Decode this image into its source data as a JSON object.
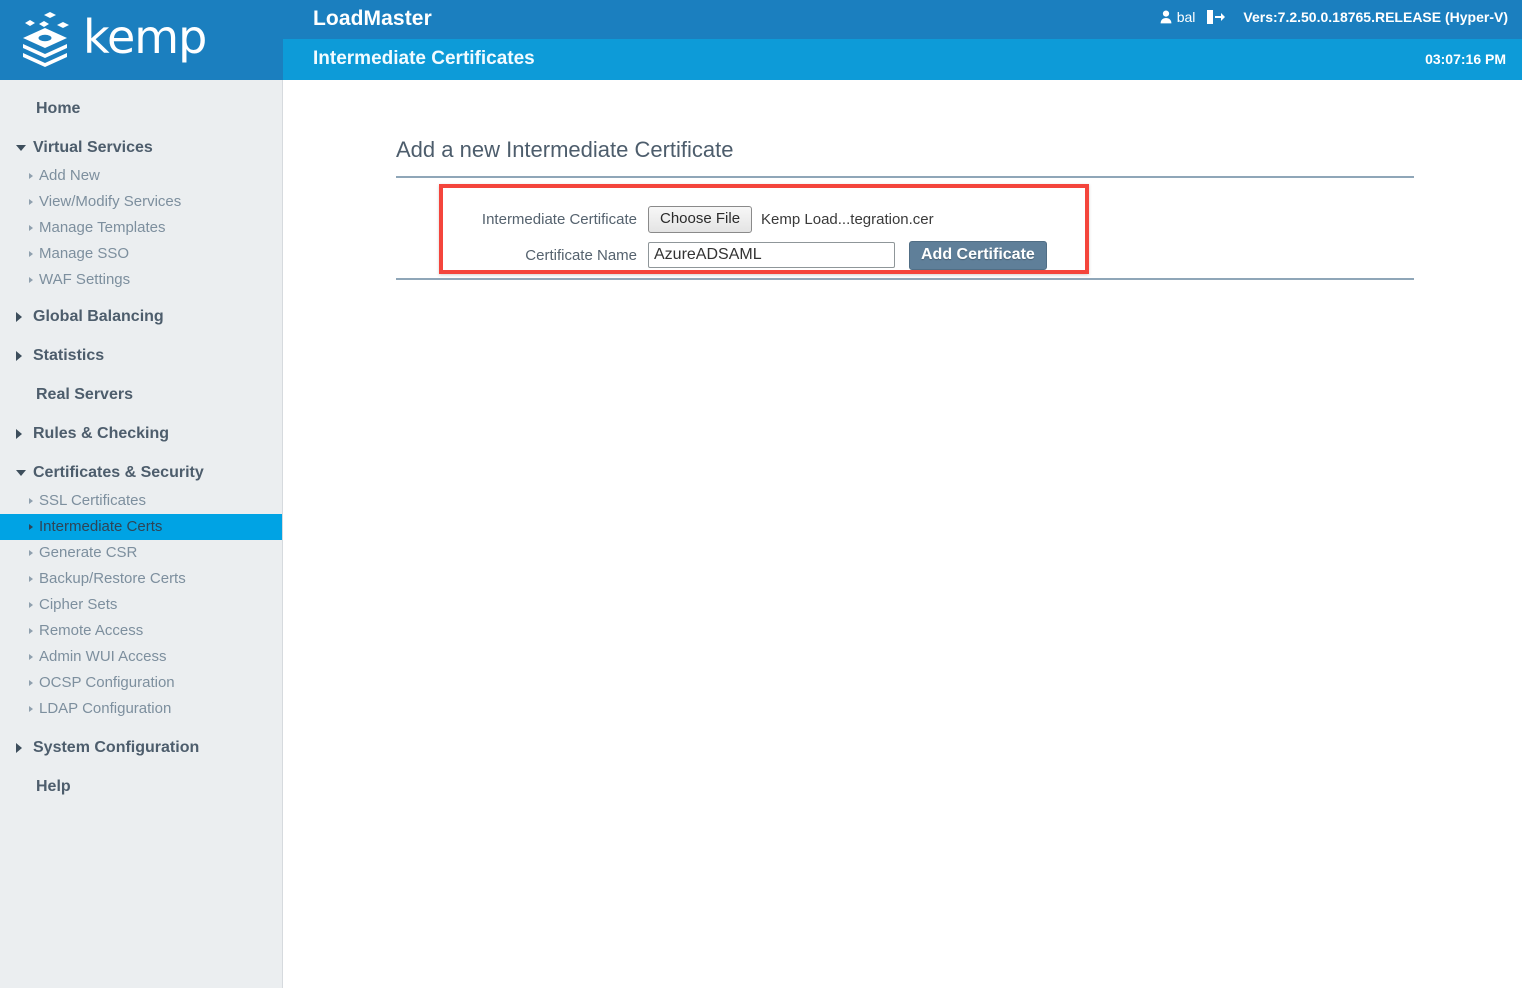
{
  "brand": {
    "name": "kemp",
    "logo_icon": "kemp-layers-logo",
    "header_bg": "#1b7fbf",
    "subheader_bg": "#0d9bd8"
  },
  "header": {
    "app_title": "LoadMaster",
    "page_title": "Intermediate Certificates",
    "user_icon": "user-icon",
    "username": "bal",
    "logout_icon": "logout-icon",
    "version": "Vers:7.2.50.0.18765.RELEASE (Hyper-V)",
    "clock": "03:07:16 PM"
  },
  "sidebar": {
    "home_label": "Home",
    "real_servers_label": "Real Servers",
    "help_label": "Help",
    "groups": [
      {
        "label": "Virtual Services",
        "expanded": true,
        "children": [
          {
            "label": "Add New",
            "active": false
          },
          {
            "label": "View/Modify Services",
            "active": false
          },
          {
            "label": "Manage Templates",
            "active": false
          },
          {
            "label": "Manage SSO",
            "active": false
          },
          {
            "label": "WAF Settings",
            "active": false
          }
        ]
      },
      {
        "label": "Global Balancing",
        "expanded": false,
        "children": []
      },
      {
        "label": "Statistics",
        "expanded": false,
        "children": []
      },
      {
        "label": "Rules & Checking",
        "expanded": false,
        "children": []
      },
      {
        "label": "Certificates & Security",
        "expanded": true,
        "children": [
          {
            "label": "SSL Certificates",
            "active": false
          },
          {
            "label": "Intermediate Certs",
            "active": true
          },
          {
            "label": "Generate CSR",
            "active": false
          },
          {
            "label": "Backup/Restore Certs",
            "active": false
          },
          {
            "label": "Cipher Sets",
            "active": false
          },
          {
            "label": "Remote Access",
            "active": false
          },
          {
            "label": "Admin WUI Access",
            "active": false
          },
          {
            "label": "OCSP Configuration",
            "active": false
          },
          {
            "label": "LDAP Configuration",
            "active": false
          }
        ]
      },
      {
        "label": "System Configuration",
        "expanded": false,
        "children": []
      }
    ],
    "active_item": "Intermediate Certs",
    "active_color": "#00a3e4"
  },
  "main": {
    "section_title": "Add a new Intermediate Certificate",
    "form": {
      "cert_file_label": "Intermediate Certificate",
      "choose_file_label": "Choose File",
      "chosen_file_name": "Kemp Load...tegration.cer",
      "cert_name_label": "Certificate Name",
      "cert_name_value": "AzureADSAML",
      "cert_name_placeholder": "",
      "add_certificate_label": "Add Certificate"
    },
    "annotation_color": "#f4453c"
  }
}
